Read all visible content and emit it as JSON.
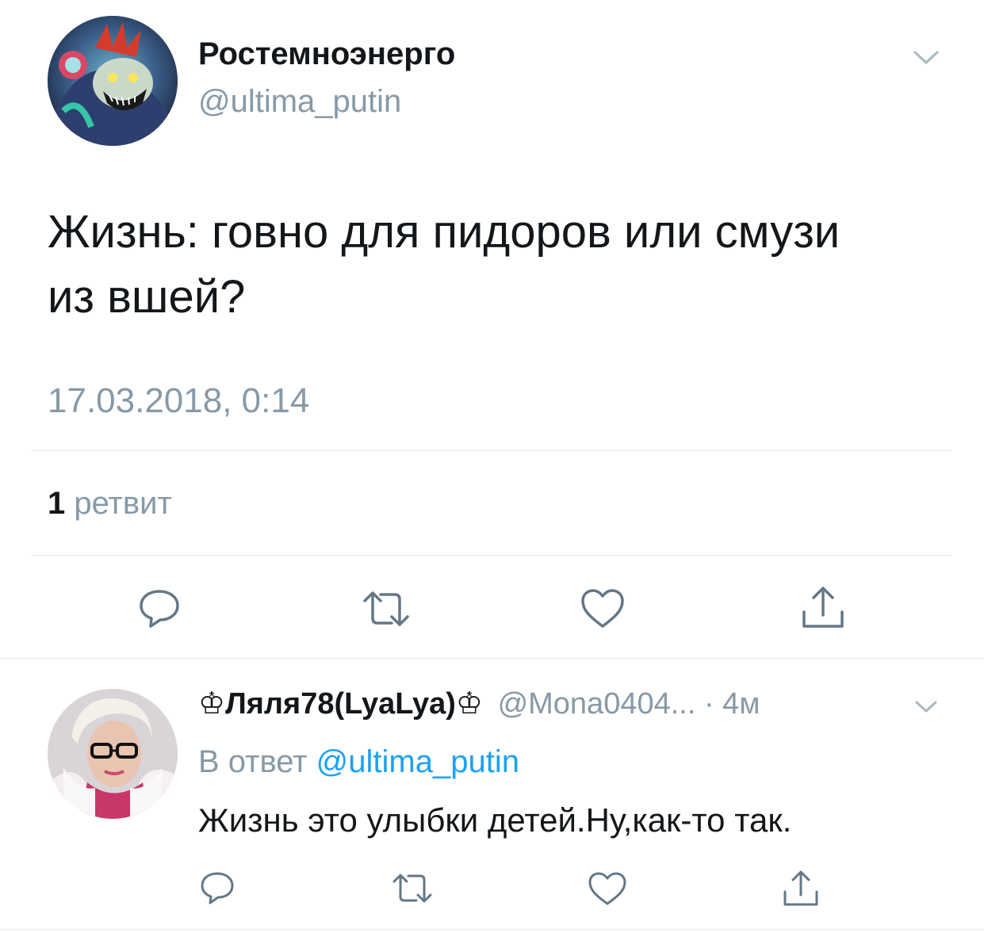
{
  "tweet": {
    "display_name": "Ростемноэнерго",
    "handle": "@ultima_putin",
    "text_line1": "Жизнь: говно для пидоров или смузи",
    "text_line2": "из вшей?",
    "timestamp": "17.03.2018, 0:14",
    "retweet_count": "1",
    "retweet_label": "ретвит",
    "icons": [
      "chevron-down-icon",
      "reply-icon",
      "retweet-icon",
      "like-icon",
      "share-icon"
    ]
  },
  "reply": {
    "display_name": "♔Ляля78(LyaLya)♔",
    "handle": "@Mona0404...",
    "time": "· 4м",
    "reply_prefix": "В ответ",
    "reply_to": "@ultima_putin",
    "text": "Жизнь это улыбки детей.Ну,как-то так.",
    "icons": [
      "chevron-down-icon",
      "reply-icon",
      "retweet-icon",
      "like-icon",
      "share-icon"
    ]
  },
  "colors": {
    "text": "#14171a",
    "muted": "#8899a6",
    "link": "#1da1f2",
    "divider": "#e1e8ed",
    "icon": "#657786"
  }
}
